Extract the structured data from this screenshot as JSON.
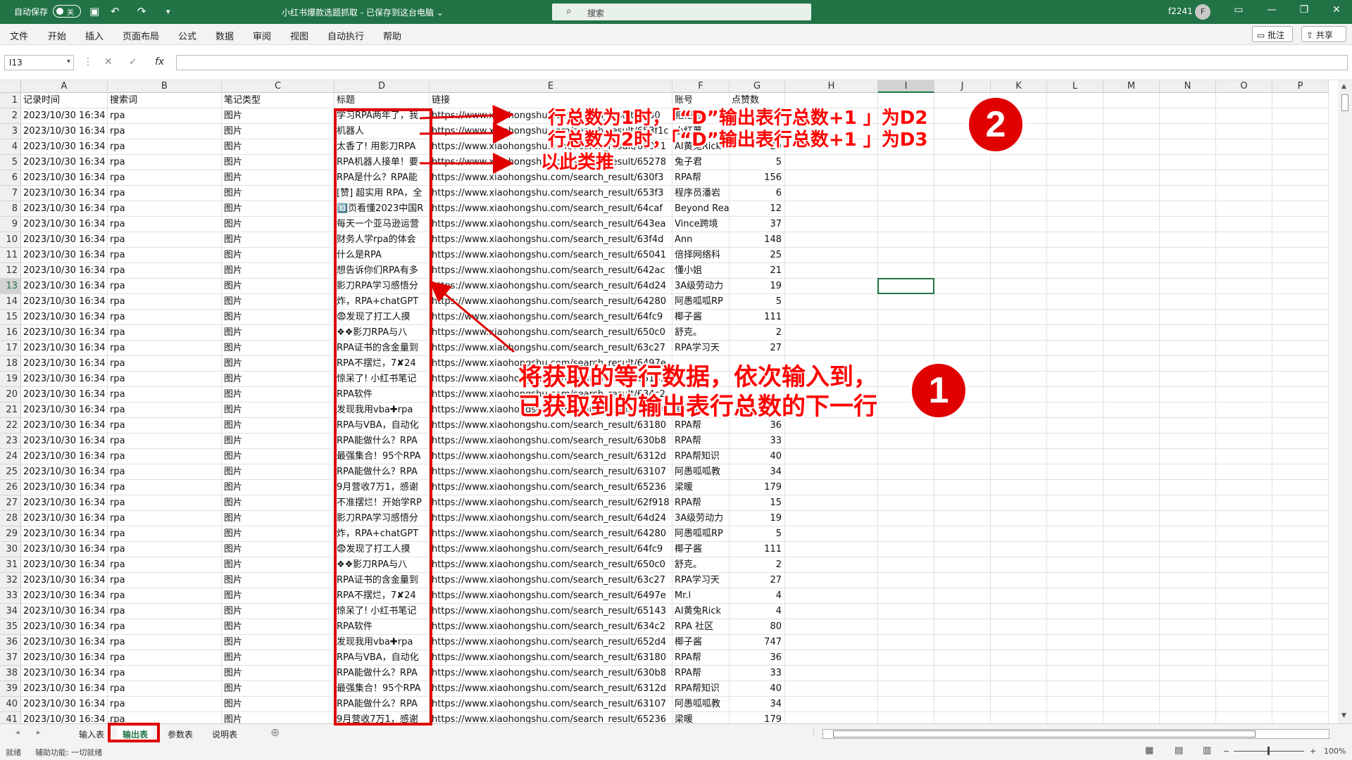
{
  "titlebar": {
    "autosave_label": "自动保存",
    "autosave_state": "关",
    "document_title": "小红书爆款选题抓取 - 已保存到这台电脑 ⌄",
    "search_placeholder": "搜索",
    "user_name": "f2241",
    "avatar_letter": "F"
  },
  "menu": [
    "文件",
    "开始",
    "插入",
    "页面布局",
    "公式",
    "数据",
    "审阅",
    "视图",
    "自动执行",
    "帮助"
  ],
  "comment_button": "批注",
  "share_button": "共享",
  "name_box": "I13",
  "fx_label": "fx",
  "columns": [
    "A",
    "B",
    "C",
    "D",
    "E",
    "F",
    "G",
    "H",
    "I",
    "J",
    "K",
    "L",
    "M",
    "N",
    "O",
    "P"
  ],
  "header_row": [
    "记录时间",
    "搜索词",
    "笔记类型",
    "标题",
    "链接",
    "账号",
    "点赞数"
  ],
  "rows": [
    [
      "2023/10/30 16:34",
      "rpa",
      "图片",
      "学习RPA两年了，我",
      "https://www.xiaohongshu.com/search_result/6530",
      "粑粑柑",
      ""
    ],
    [
      "2023/10/30 16:34",
      "rpa",
      "图片",
      "机器人",
      "https://www.xiaohongshu.com/search_result/653f1c",
      "小红薯",
      ""
    ],
    [
      "2023/10/30 16:34",
      "rpa",
      "图片",
      "太香了! 用影刀RPA",
      "https://www.xiaohongshu.com/search_result/65091",
      "AI黄兔Rick",
      "20"
    ],
    [
      "2023/10/30 16:34",
      "rpa",
      "图片",
      "RPA机器人接单！要",
      "https://www.xiaohongshu.com/search_result/65278",
      "兔子君",
      "5"
    ],
    [
      "2023/10/30 16:34",
      "rpa",
      "图片",
      "RPA是什么？RPA能",
      "https://www.xiaohongshu.com/search_result/630f3",
      "RPA帮",
      "156"
    ],
    [
      "2023/10/30 16:34",
      "rpa",
      "图片",
      "[赞] 超实用 RPA，全",
      "https://www.xiaohongshu.com/search_result/653f3",
      "程序员潘岩",
      "6"
    ],
    [
      "2023/10/30 16:34",
      "rpa",
      "图片",
      "🔟页看懂2023中国R",
      "https://www.xiaohongshu.com/search_result/64caf",
      "Beyond Rea",
      "12"
    ],
    [
      "2023/10/30 16:34",
      "rpa",
      "图片",
      "每天一个亚马逊运营",
      "https://www.xiaohongshu.com/search_result/643ea",
      "Vince跨境",
      "37"
    ],
    [
      "2023/10/30 16:34",
      "rpa",
      "图片",
      "财务人学rpa的体会",
      "https://www.xiaohongshu.com/search_result/63f4d",
      "Ann",
      "148"
    ],
    [
      "2023/10/30 16:34",
      "rpa",
      "图片",
      "什么是RPA",
      "https://www.xiaohongshu.com/search_result/65041",
      "倍择网络科",
      "25"
    ],
    [
      "2023/10/30 16:34",
      "rpa",
      "图片",
      "想告诉你们RPA有多",
      "https://www.xiaohongshu.com/search_result/642ac",
      "懂小姐",
      "21"
    ],
    [
      "2023/10/30 16:34",
      "rpa",
      "图片",
      "影刀RPA学习感悟分",
      "https://www.xiaohongshu.com/search_result/64d24",
      "3A级劳动力",
      "19"
    ],
    [
      "2023/10/30 16:34",
      "rpa",
      "图片",
      "炸，RPA+chatGPT",
      "https://www.xiaohongshu.com/search_result/64280",
      "阿愚呱呱RP",
      "5"
    ],
    [
      "2023/10/30 16:34",
      "rpa",
      "图片",
      "😨发现了打工人摸",
      "https://www.xiaohongshu.com/search_result/64fc9",
      "椰子酱",
      "111"
    ],
    [
      "2023/10/30 16:34",
      "rpa",
      "图片",
      "❖❖影刀RPA与八",
      "https://www.xiaohongshu.com/search_result/650c0",
      "舒克。",
      "2"
    ],
    [
      "2023/10/30 16:34",
      "rpa",
      "图片",
      "RPA证书的含金量到",
      "https://www.xiaohongshu.com/search_result/63c27",
      "RPA学习天",
      "27"
    ],
    [
      "2023/10/30 16:34",
      "rpa",
      "图片",
      "RPA不摆烂，7✘24",
      "https://www.xiaohongshu.com/search_result/6497e",
      "",
      ""
    ],
    [
      "2023/10/30 16:34",
      "rpa",
      "图片",
      "惊呆了! 小红书笔记",
      "https://www.xiaohongshu.com/search_result/65143",
      "",
      ""
    ],
    [
      "2023/10/30 16:34",
      "rpa",
      "图片",
      "RPA软件",
      "https://www.xiaohongshu.com/search_result/634c2",
      "",
      ""
    ],
    [
      "2023/10/30 16:34",
      "rpa",
      "图片",
      "发现我用vba✚rpa",
      "https://www.xiaohongshu.com/search_result/652d4",
      "椰子酱",
      ""
    ],
    [
      "2023/10/30 16:34",
      "rpa",
      "图片",
      "RPA与VBA，自动化",
      "https://www.xiaohongshu.com/search_result/63180",
      "RPA帮",
      "36"
    ],
    [
      "2023/10/30 16:34",
      "rpa",
      "图片",
      "RPA能做什么？RPA",
      "https://www.xiaohongshu.com/search_result/630b8",
      "RPA帮",
      "33"
    ],
    [
      "2023/10/30 16:34",
      "rpa",
      "图片",
      "最强集合！95个RPA",
      "https://www.xiaohongshu.com/search_result/6312d",
      "RPA帮知识",
      "40"
    ],
    [
      "2023/10/30 16:34",
      "rpa",
      "图片",
      "RPA能做什么？RPA",
      "https://www.xiaohongshu.com/search_result/63107",
      "阿愚呱呱教",
      "34"
    ],
    [
      "2023/10/30 16:34",
      "rpa",
      "图片",
      "9月营收7万1，感谢",
      "https://www.xiaohongshu.com/search_result/65236",
      "梁暖",
      "179"
    ],
    [
      "2023/10/30 16:34",
      "rpa",
      "图片",
      "不准摆烂！开始学RP",
      "https://www.xiaohongshu.com/search_result/62f918",
      "RPA帮",
      "15"
    ],
    [
      "2023/10/30 16:34",
      "rpa",
      "图片",
      "影刀RPA学习感悟分",
      "https://www.xiaohongshu.com/search_result/64d24",
      "3A级劳动力",
      "19"
    ],
    [
      "2023/10/30 16:34",
      "rpa",
      "图片",
      "炸，RPA+chatGPT",
      "https://www.xiaohongshu.com/search_result/64280",
      "阿愚呱呱RP",
      "5"
    ],
    [
      "2023/10/30 16:34",
      "rpa",
      "图片",
      "😨发现了打工人摸",
      "https://www.xiaohongshu.com/search_result/64fc9",
      "椰子酱",
      "111"
    ],
    [
      "2023/10/30 16:34",
      "rpa",
      "图片",
      "❖❖影刀RPA与八",
      "https://www.xiaohongshu.com/search_result/650c0",
      "舒克。",
      "2"
    ],
    [
      "2023/10/30 16:34",
      "rpa",
      "图片",
      "RPA证书的含金量到",
      "https://www.xiaohongshu.com/search_result/63c27",
      "RPA学习天",
      "27"
    ],
    [
      "2023/10/30 16:34",
      "rpa",
      "图片",
      "RPA不摆烂，7✘24",
      "https://www.xiaohongshu.com/search_result/6497e",
      "Mr.l",
      "4"
    ],
    [
      "2023/10/30 16:34",
      "rpa",
      "图片",
      "惊呆了! 小红书笔记",
      "https://www.xiaohongshu.com/search_result/65143",
      "AI黄兔Rick",
      "4"
    ],
    [
      "2023/10/30 16:34",
      "rpa",
      "图片",
      "RPA软件",
      "https://www.xiaohongshu.com/search_result/634c2",
      "RPA 社区",
      "80"
    ],
    [
      "2023/10/30 16:34",
      "rpa",
      "图片",
      "发现我用vba✚rpa",
      "https://www.xiaohongshu.com/search_result/652d4",
      "椰子酱",
      "747"
    ],
    [
      "2023/10/30 16:34",
      "rpa",
      "图片",
      "RPA与VBA，自动化",
      "https://www.xiaohongshu.com/search_result/63180",
      "RPA帮",
      "36"
    ],
    [
      "2023/10/30 16:34",
      "rpa",
      "图片",
      "RPA能做什么？RPA",
      "https://www.xiaohongshu.com/search_result/630b8",
      "RPA帮",
      "33"
    ],
    [
      "2023/10/30 16:34",
      "rpa",
      "图片",
      "最强集合！95个RPA",
      "https://www.xiaohongshu.com/search_result/6312d",
      "RPA帮知识",
      "40"
    ],
    [
      "2023/10/30 16:34",
      "rpa",
      "图片",
      "RPA能做什么？RPA",
      "https://www.xiaohongshu.com/search_result/63107",
      "阿愚呱呱教",
      "34"
    ],
    [
      "2023/10/30 16:34",
      "rpa",
      "图片",
      "9月营收7万1，感谢",
      "https://www.xiaohongshu.com/search_result/65236",
      "梁暖",
      "179"
    ]
  ],
  "sheets": [
    "输入表",
    "输出表",
    "参数表",
    "说明表"
  ],
  "active_sheet": "输出表",
  "status": {
    "ready": "就绪",
    "accessibility": "辅助功能: 一切就绪",
    "zoom": "100%"
  },
  "annotations": {
    "note_top_1": "行总数为1时，「“D”输出表行总数+1 」为D2",
    "note_top_2": "行总数为2时，「“D”输出表行总数+1 」为D3",
    "note_top_3": "以此类推",
    "note_main_1": "将获取的等行数据，依次输入到，",
    "note_main_2": "已获取到的输出表行总数的下一行",
    "badge_1": "1",
    "badge_2": "2"
  },
  "colors": {
    "excel_green": "#217346",
    "annotation_red": "#e00000"
  }
}
